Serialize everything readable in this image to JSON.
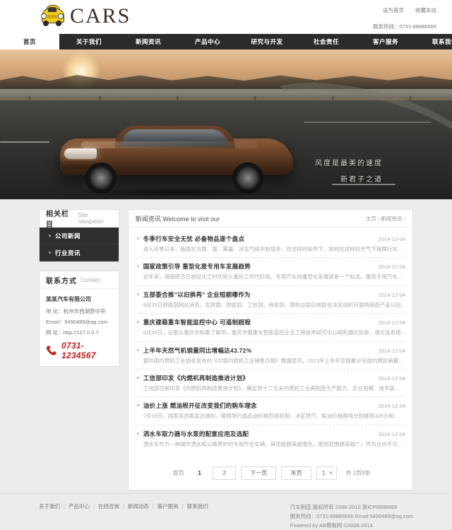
{
  "header": {
    "logo_text": "CARS",
    "logo_icon": "car-icon",
    "top_links": [
      "设为首页",
      "收藏本站"
    ],
    "hotline": "服务热线：0731-88886666"
  },
  "nav": {
    "items": [
      {
        "label": "首页",
        "active": true
      },
      {
        "label": "关于我们",
        "active": false
      },
      {
        "label": "新闻资讯",
        "active": false
      },
      {
        "label": "产品中心",
        "active": false
      },
      {
        "label": "研究与开发",
        "active": false
      },
      {
        "label": "社会责任",
        "active": false
      },
      {
        "label": "客户服务",
        "active": false
      },
      {
        "label": "联系我们",
        "active": false
      }
    ]
  },
  "banner": {
    "line1": "风度是最美的速度",
    "line2": "新君子之道"
  },
  "sidebar": {
    "nav_panel": {
      "title_cn": "相关栏目",
      "title_en": "Site navigation",
      "items": [
        "公司新闻",
        "行业资讯"
      ]
    },
    "contact_panel": {
      "title_cn": "联系方式",
      "title_en": "Contact",
      "company": "某某汽车有限公司",
      "address": "地 址：杭州市西湖景中央",
      "email": "Email：9490489@qq.com",
      "website": "网 址：http://127.0.0.7",
      "phone_icon": "phone-icon",
      "phone": "0731-1234567"
    }
  },
  "news": {
    "title_cn": "新闻资讯",
    "title_en": "Welcome to visit our",
    "breadcrumb": "主页 › 新闻资讯 ›",
    "items": [
      {
        "title": "冬季行车安全无忧 必备物品逐个盘点",
        "date": "2014-12-04",
        "desc": "进入冬季以来，我国北方雨、雪、雾霾、冰冻气候开始增多，在这样的条件下，如何在这样的天气下保障行车..."
      },
      {
        "title": "国家政策引导 重型化是专用车发展趋势",
        "date": "2014-12-04",
        "desc": "近年来，我国经济已由轻化工时代转入重化工时代阶段，专用汽车向重型化发展就是一个标志。重型专用汽车..."
      },
      {
        "title": "五部委合推\"以旧换再\" 企业短期哪作为",
        "date": "2014-12-04",
        "desc": "8月26日财政部网站消息，发改委、财政部、工信部、商务部、质检总局日前联合决定组织开展再制造产品以旧..."
      },
      {
        "title": "重庆建稳重车智能监控中心 可遥制超程",
        "date": "2014-12-04",
        "desc": "6月25日，记者从重庆市科委了解到，重庆市载重车智能监控企业工程技术研究中心顺利通过验收，通过该系统..."
      },
      {
        "title": "上半年天然气机销量同比增幅达43.72%",
        "date": "2014-12-04",
        "desc": "据中国内燃机工业协会发布的《中国内燃机工业销售月报》数据显示，2013年上半年全国累计完成内燃机销量..."
      },
      {
        "title": "工信部印发《内燃机再制造推进计划》",
        "date": "2014-12-04",
        "desc": "工信部日前印发《内燃机再制造推进计划》，确定到十二五末内燃机工业再制造生产能力、企业规模、技术装..."
      },
      {
        "title": "油价上涨 燃油税开征改变我们的购车理念",
        "date": "2014-12-04",
        "desc": "7月19日，国家发改委发出通知，按照现行成品油价格形成机制，决定将汽、柴油价格每吨分别提高325元和..."
      },
      {
        "title": "洒水车取力器与水泵的配套应用及选配",
        "date": "2014-12-04",
        "desc": "洒水车作为一种城市洒水和公路养护的专用作业车辆，其功能越来越强化，使用范围越来越广，作为业内不可..."
      }
    ],
    "pager": {
      "first": "首页",
      "page1": "1",
      "page2": "2",
      "next": "下一页",
      "last": "末页",
      "select_value": "1",
      "info": "共 2页9条"
    }
  },
  "footer": {
    "links": [
      "关于我们",
      "产品中心",
      "在线咨询",
      "新闻动态",
      "客户服务",
      "联系我们"
    ],
    "copyright": "汽车制造 版权所有 2008-2012 浙ICP8888989",
    "contact": "服务热线：0731-88886666 Email:9490489@qq.com",
    "powered": "Powered by AB模板网 ©2008-2014"
  }
}
